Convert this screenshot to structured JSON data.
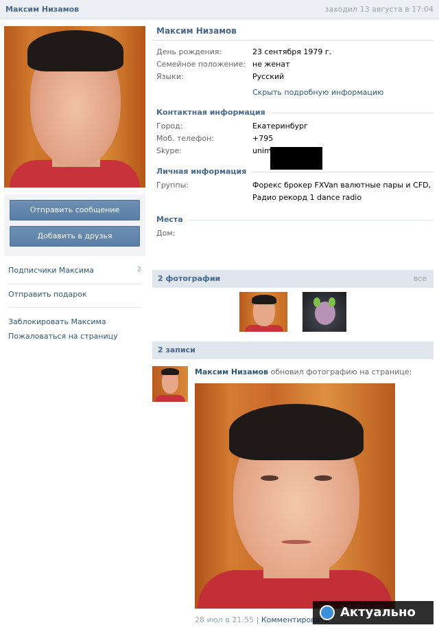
{
  "header": {
    "name": "Максим Низамов",
    "last_seen": "заходил 13 августа в 17:04"
  },
  "actions": {
    "send_message": "Отправить сообщение",
    "add_friend": "Добавить в друзья"
  },
  "left_menu": {
    "subscribers": "Подписчики Максима",
    "subscribers_count": "2",
    "send_gift": "Отправить подарок",
    "block": "Заблокировать Максима",
    "report": "Пожаловаться на страницу"
  },
  "profile": {
    "name": "Максим Низамов",
    "birthday_label": "День рождения:",
    "birthday": "23 сентября 1979 г.",
    "family_label": "Семейное положение:",
    "family": "не женат",
    "languages_label": "Языки:",
    "languages": "Русский",
    "hide_link": "Скрыть подробную информацию",
    "contact_section": "Контактная информация",
    "city_label": "Город:",
    "city": "Екатеринбург",
    "phone_label": "Моб. телефон:",
    "phone": "+795",
    "skype_label": "Skype:",
    "skype": "unim",
    "personal_section": "Личная информация",
    "groups_label": "Группы:",
    "groups_line1": "Форекс брокер FXVan валютные пары и CFD,",
    "groups_line2": "Радио рекорд 1 dance radio",
    "places_section": "Места",
    "home_label": "Дом:"
  },
  "photos": {
    "title": "2 фотографии",
    "all": "все"
  },
  "posts": {
    "title": "2 записи",
    "author": "Максим Низамов",
    "action": "обновил фотографию на странице:",
    "date": "28 июл в 21:55",
    "comment": "Комментировать"
  },
  "watermark": "Актуально"
}
